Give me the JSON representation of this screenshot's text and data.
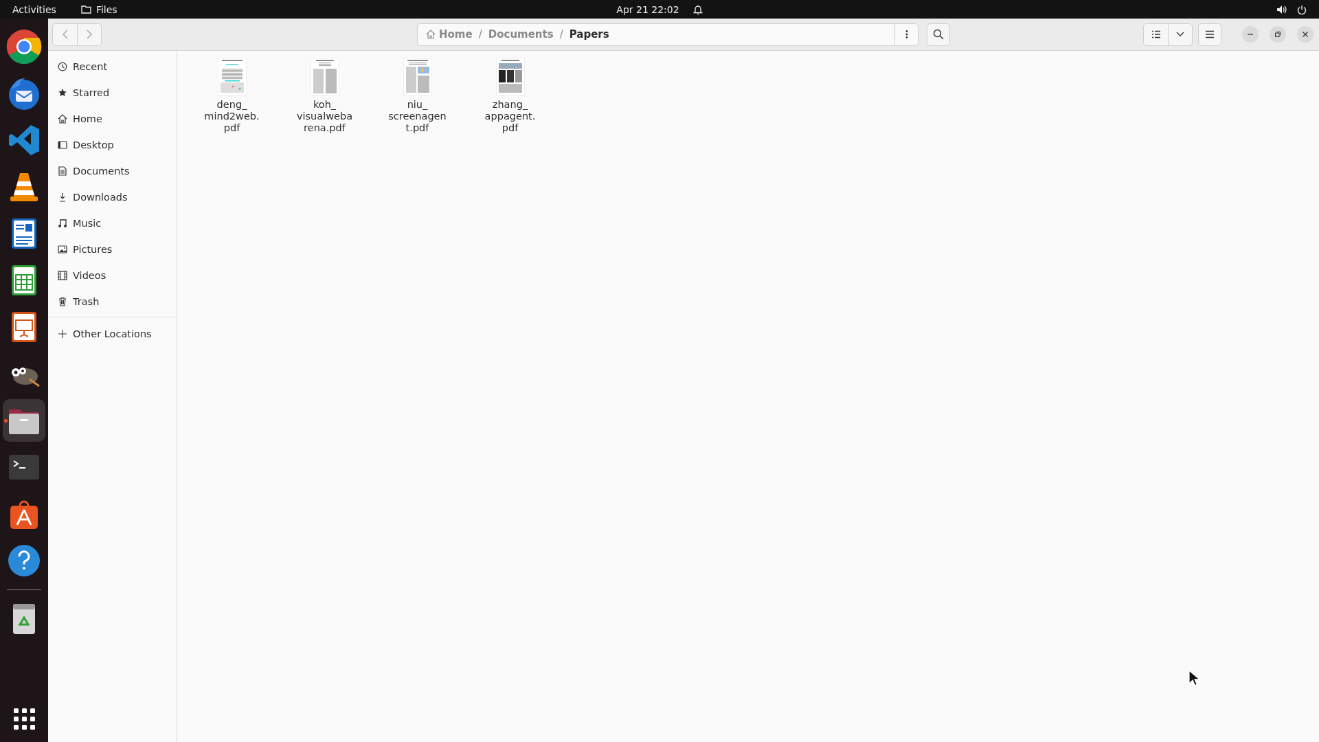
{
  "top_bar": {
    "activities": "Activities",
    "app_name": "Files",
    "clock": "Apr 21  22:02"
  },
  "dock": [
    {
      "kind": "chrome",
      "running": false
    },
    {
      "kind": "thunderbird",
      "running": false
    },
    {
      "kind": "vscode",
      "running": false
    },
    {
      "kind": "vlc",
      "running": false
    },
    {
      "kind": "writer",
      "running": false
    },
    {
      "kind": "calc",
      "running": false
    },
    {
      "kind": "impress",
      "running": false
    },
    {
      "kind": "gimp",
      "running": false
    },
    {
      "kind": "files",
      "running": true
    },
    {
      "kind": "terminal",
      "running": false
    },
    {
      "kind": "appstore",
      "running": false
    },
    {
      "kind": "help",
      "running": false
    },
    {
      "kind": "trash",
      "running": false
    }
  ],
  "path_bar": {
    "crumbs": [
      {
        "label": "Home",
        "selected": false
      },
      {
        "label": "Documents",
        "selected": false
      },
      {
        "label": "Papers",
        "selected": true
      }
    ],
    "separator": "/"
  },
  "sidebar": {
    "items": [
      {
        "label": "Recent",
        "selected": false
      },
      {
        "label": "Starred",
        "selected": false
      },
      {
        "label": "Home",
        "selected": false
      },
      {
        "label": "Desktop",
        "selected": false
      },
      {
        "label": "Documents",
        "selected": false
      },
      {
        "label": "Downloads",
        "selected": false
      },
      {
        "label": "Music",
        "selected": false
      },
      {
        "label": "Pictures",
        "selected": false
      },
      {
        "label": "Videos",
        "selected": false
      },
      {
        "label": "Trash",
        "selected": false
      }
    ],
    "other": {
      "label": "Other Locations",
      "selected": false
    }
  },
  "files": [
    {
      "name_lines": [
        "deng_",
        "mind2web.",
        "pdf"
      ]
    },
    {
      "name_lines": [
        "koh_",
        "visualweba",
        "rena.pdf"
      ]
    },
    {
      "name_lines": [
        "niu_",
        "screenagen",
        "t.pdf"
      ]
    },
    {
      "name_lines": [
        "zhang_",
        "appagent.",
        "pdf"
      ]
    }
  ]
}
